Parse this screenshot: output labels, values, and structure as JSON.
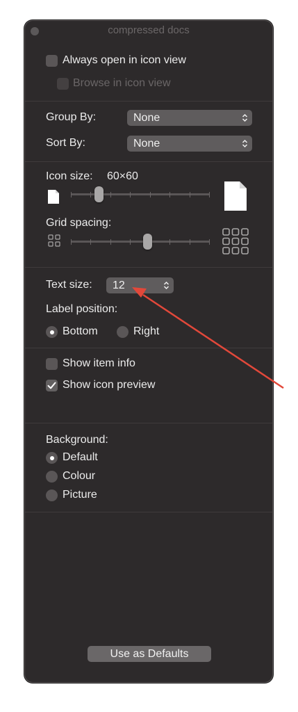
{
  "window": {
    "title": "compressed docs"
  },
  "view_options": {
    "always_open_label": "Always open in icon view",
    "browse_label": "Browse in icon view"
  },
  "group_sort": {
    "group_by_label": "Group By:",
    "group_by_value": "None",
    "sort_by_label": "Sort By:",
    "sort_by_value": "None"
  },
  "icon_options": {
    "icon_size_label": "Icon size:",
    "icon_size_value": "60×60",
    "icon_size_level": 0.2,
    "grid_spacing_label": "Grid spacing:",
    "grid_spacing_level": 0.55
  },
  "text_options": {
    "text_size_label": "Text size:",
    "text_size_value": "12",
    "label_position_label": "Label position:",
    "bottom_label": "Bottom",
    "right_label": "Right",
    "selected_position": "Bottom"
  },
  "info_options": {
    "show_item_info_label": "Show item info",
    "show_item_info_checked": false,
    "show_icon_preview_label": "Show icon preview",
    "show_icon_preview_checked": true
  },
  "background": {
    "heading": "Background:",
    "default_label": "Default",
    "colour_label": "Colour",
    "picture_label": "Picture",
    "selected": "Default"
  },
  "footer": {
    "use_as_defaults_label": "Use as Defaults"
  },
  "colors": {
    "window_bg": "#2d2a2b",
    "annotation_arrow": "#e2483a"
  }
}
